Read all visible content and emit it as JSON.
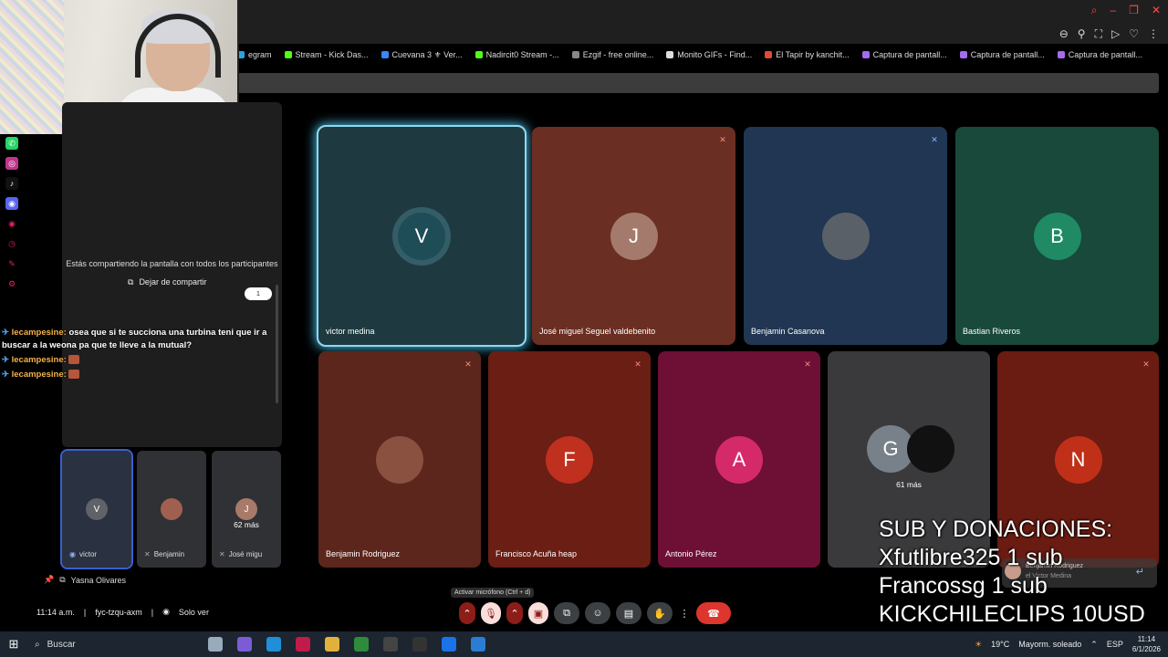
{
  "browser": {
    "bookmarks": [
      {
        "label": "egram",
        "color": "#2aa3dd"
      },
      {
        "label": "Stream - Kick Das...",
        "color": "#53fc18"
      },
      {
        "label": "Cuevana 3 ⚜ Ver...",
        "color": "#3a86ff"
      },
      {
        "label": "Nadircit0 Stream -...",
        "color": "#53fc18"
      },
      {
        "label": "Ezgif - free online...",
        "color": "#888888"
      },
      {
        "label": "Monito GIFs - Find...",
        "color": "#dddddd"
      },
      {
        "label": "El Tapir by kanchit...",
        "color": "#e04a3a"
      },
      {
        "label": "Captura de pantall...",
        "color": "#a56cf0"
      },
      {
        "label": "Captura de pantall...",
        "color": "#a56cf0"
      },
      {
        "label": "Captura de pantall...",
        "color": "#a56cf0"
      }
    ]
  },
  "left_panel": {
    "share_text": "Estás compartiendo la pantalla con todos los participantes",
    "stop_share_label": "Dejar de compartir",
    "page_pill": "1"
  },
  "chat": [
    {
      "user": "lecampesine:",
      "message": "osea que si te succiona una turbina teni que ir a buscar a la weona pa que te lleve a la mutual?"
    },
    {
      "user": "lecampesine:",
      "message": ""
    },
    {
      "user": "lecampesine:",
      "message": ""
    }
  ],
  "mini_tiles": [
    {
      "initial": "V",
      "name": "victor",
      "color": "#5f6368",
      "more": ""
    },
    {
      "initial": "",
      "name": "Benjamin",
      "color": "#a06050",
      "more": ""
    },
    {
      "initial": "J",
      "name": "José migu",
      "color": "#a87a6a",
      "more": "62 más"
    }
  ],
  "pinned_name": "Yasna Olivares",
  "meeting": {
    "time": "11:14 a.m.",
    "code": "fyc-tzqu-axm",
    "view_label": "Solo ver"
  },
  "tiles": [
    {
      "name": "victor medina",
      "initial": "V",
      "bg": "#1e3a40",
      "avatar": "#1f4d57",
      "mic": "",
      "active": true
    },
    {
      "name": "José miguel Seguel valdebenito",
      "initial": "J",
      "bg": "#6b2e22",
      "avatar": "#a47a6c",
      "mic": "red"
    },
    {
      "name": "Benjamin Casanova",
      "initial": "",
      "bg": "#203652",
      "avatar": "#5a6068",
      "mic": "blue"
    },
    {
      "name": "Bastian Riveros",
      "initial": "B",
      "bg": "#18493a",
      "avatar": "#1f8a64",
      "mic": ""
    },
    {
      "name": "Benjamin Rodriguez",
      "initial": "",
      "bg": "#5c261c",
      "avatar": "#8a5040",
      "mic": "red"
    },
    {
      "name": "Francisco Acuña heap",
      "initial": "F",
      "bg": "#6a1e14",
      "avatar": "#c0301e",
      "mic": "red"
    },
    {
      "name": "Antonio Pérez",
      "initial": "A",
      "bg": "#6e0f36",
      "avatar": "#d42a6a",
      "mic": "red"
    },
    {
      "name": "",
      "initial": "G",
      "bg": "#3a3a3c",
      "avatar": "#78808a",
      "mic": "",
      "more": "61 más"
    },
    {
      "name": "",
      "initial": "N",
      "bg": "#6a1c12",
      "avatar": "#c03018",
      "mic": "red"
    }
  ],
  "controls": {
    "tooltip": "Activar micrófono (Ctrl + d)"
  },
  "donations": [
    "SUB Y DONACIONES:",
    "Xfutlibre325 1 sub",
    "Francossg 1 sub",
    "KICKCHILECLIPS 10USD"
  ],
  "notification": {
    "title": "Benjamin Rodriguez",
    "subtitle": "el Victor Medina"
  },
  "taskbar": {
    "search_placeholder": "Buscar",
    "weather": "19°C",
    "weather_desc": "Mayorm. soleado",
    "lang": "ESP",
    "time": "11:14",
    "date": "6/1/2026"
  }
}
